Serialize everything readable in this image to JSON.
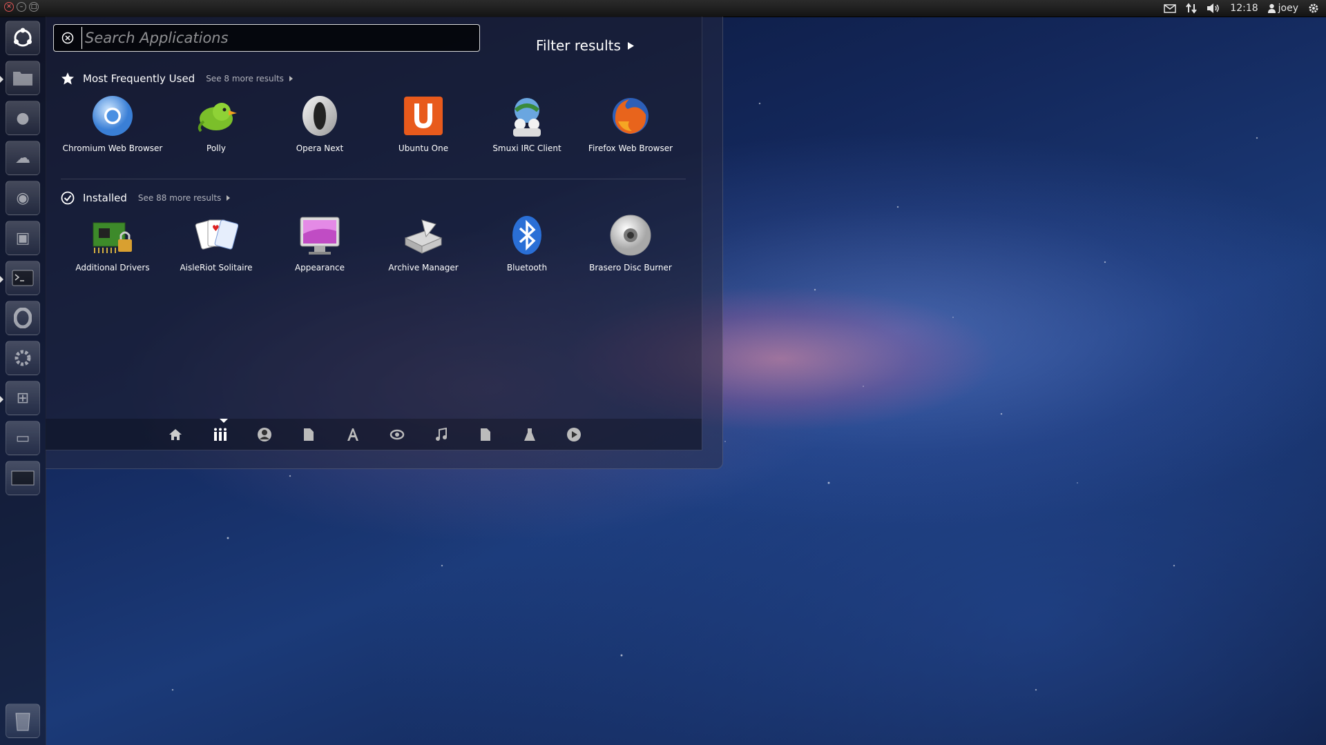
{
  "top_panel": {
    "clock": "12:18",
    "user": "joey",
    "icons": [
      "mail-icon",
      "network-icon",
      "volume-icon",
      "user-icon",
      "gear-icon"
    ]
  },
  "launcher": {
    "items": [
      {
        "name": "dash-home",
        "icon": "ubuntu-logo-icon"
      },
      {
        "name": "files",
        "icon": "folder-icon"
      },
      {
        "name": "app-2",
        "icon": "app-icon"
      },
      {
        "name": "app-3",
        "icon": "app-icon"
      },
      {
        "name": "app-4",
        "icon": "app-icon"
      },
      {
        "name": "app-5",
        "icon": "app-icon"
      },
      {
        "name": "terminal",
        "icon": "terminal-icon"
      },
      {
        "name": "opera",
        "icon": "opera-icon"
      },
      {
        "name": "settings",
        "icon": "gear-icon"
      },
      {
        "name": "app-9",
        "icon": "app-icon"
      },
      {
        "name": "app-10",
        "icon": "app-icon"
      },
      {
        "name": "workspaces",
        "icon": "workspace-icon"
      },
      {
        "name": "trash",
        "icon": "trash-icon"
      }
    ]
  },
  "dash": {
    "search": {
      "placeholder": "Search Applications",
      "value": ""
    },
    "filter_label": "Filter results",
    "sections": [
      {
        "title": "Most Frequently Used",
        "see_more": "See 8 more results",
        "apps": [
          {
            "label": "Chromium Web Browser",
            "icon": "chromium-icon"
          },
          {
            "label": "Polly",
            "icon": "polly-bird-icon"
          },
          {
            "label": "Opera Next",
            "icon": "opera-icon"
          },
          {
            "label": "Ubuntu One",
            "icon": "ubuntu-one-icon"
          },
          {
            "label": "Smuxi IRC Client",
            "icon": "smuxi-icon"
          },
          {
            "label": "Firefox Web Browser",
            "icon": "firefox-icon"
          }
        ]
      },
      {
        "title": "Installed",
        "see_more": "See 88 more results",
        "apps": [
          {
            "label": "Additional Drivers",
            "icon": "drivers-chip-icon"
          },
          {
            "label": "AisleRiot Solitaire",
            "icon": "playing-cards-icon"
          },
          {
            "label": "Appearance",
            "icon": "monitor-icon"
          },
          {
            "label": "Archive Manager",
            "icon": "archive-icon"
          },
          {
            "label": "Bluetooth",
            "icon": "bluetooth-icon"
          },
          {
            "label": "Brasero Disc Burner",
            "icon": "disc-icon"
          }
        ]
      }
    ],
    "lenses": [
      {
        "name": "home",
        "icon": "home-icon"
      },
      {
        "name": "applications",
        "icon": "applications-icon",
        "active": true
      },
      {
        "name": "people",
        "icon": "people-icon"
      },
      {
        "name": "files",
        "icon": "file-icon"
      },
      {
        "name": "fonts",
        "icon": "font-icon"
      },
      {
        "name": "photos",
        "icon": "photo-icon"
      },
      {
        "name": "music",
        "icon": "music-icon"
      },
      {
        "name": "documents",
        "icon": "document-icon"
      },
      {
        "name": "science",
        "icon": "flask-icon"
      },
      {
        "name": "video",
        "icon": "play-icon"
      }
    ]
  },
  "colors": {
    "accent": "#ffffff",
    "panel_bg": "#1f1f1f",
    "ubuntu_one_orange": "#e85a1c",
    "bluetooth_blue": "#2a6fd6"
  }
}
